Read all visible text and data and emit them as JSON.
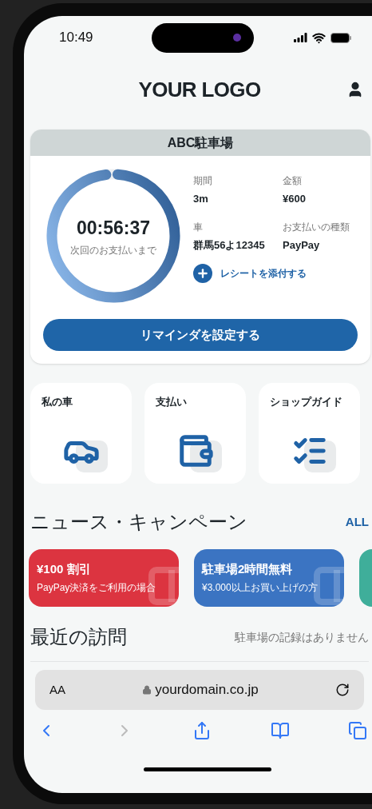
{
  "status_bar": {
    "time": "10:49"
  },
  "header": {
    "logo": "YOUR LOGO"
  },
  "parking_card": {
    "title": "ABC駐車場",
    "timer": {
      "time": "00:56:37",
      "caption": "次回のお支払いまで",
      "level": 0.97
    },
    "details": [
      {
        "label": "期間",
        "value": "3m"
      },
      {
        "label": "金額",
        "value": "¥600"
      },
      {
        "label": "車",
        "value": "群馬56よ12345"
      },
      {
        "label": "お支払いの種類",
        "value": "PayPay"
      }
    ],
    "receipt_link": "レシートを添付する",
    "reminder_button": "リマインダを設定する"
  },
  "shortcuts": [
    {
      "label": "私の車",
      "kind": "car"
    },
    {
      "label": "支払い",
      "kind": "wallet"
    },
    {
      "label": "ショップガイド",
      "kind": "checklist"
    }
  ],
  "news": {
    "title": "ニュース・キャンペーン",
    "all_link": "ALL",
    "promos": [
      {
        "title": "¥100 割引",
        "subtitle": "PayPay決済をご利用の場合",
        "color": "#dc3440"
      },
      {
        "title": "駐車場2時間無料",
        "subtitle": "¥3.000以上お買い上げの方",
        "color": "#3b74c2"
      },
      {
        "color": "#3fae9a"
      }
    ]
  },
  "recent": {
    "title": "最近の訪問",
    "empty_text": "駐車場の記録はありません"
  },
  "browser": {
    "text_size": "AA",
    "url": "yourdomain.co.jp",
    "back_disabled": false,
    "forward_disabled": true
  }
}
